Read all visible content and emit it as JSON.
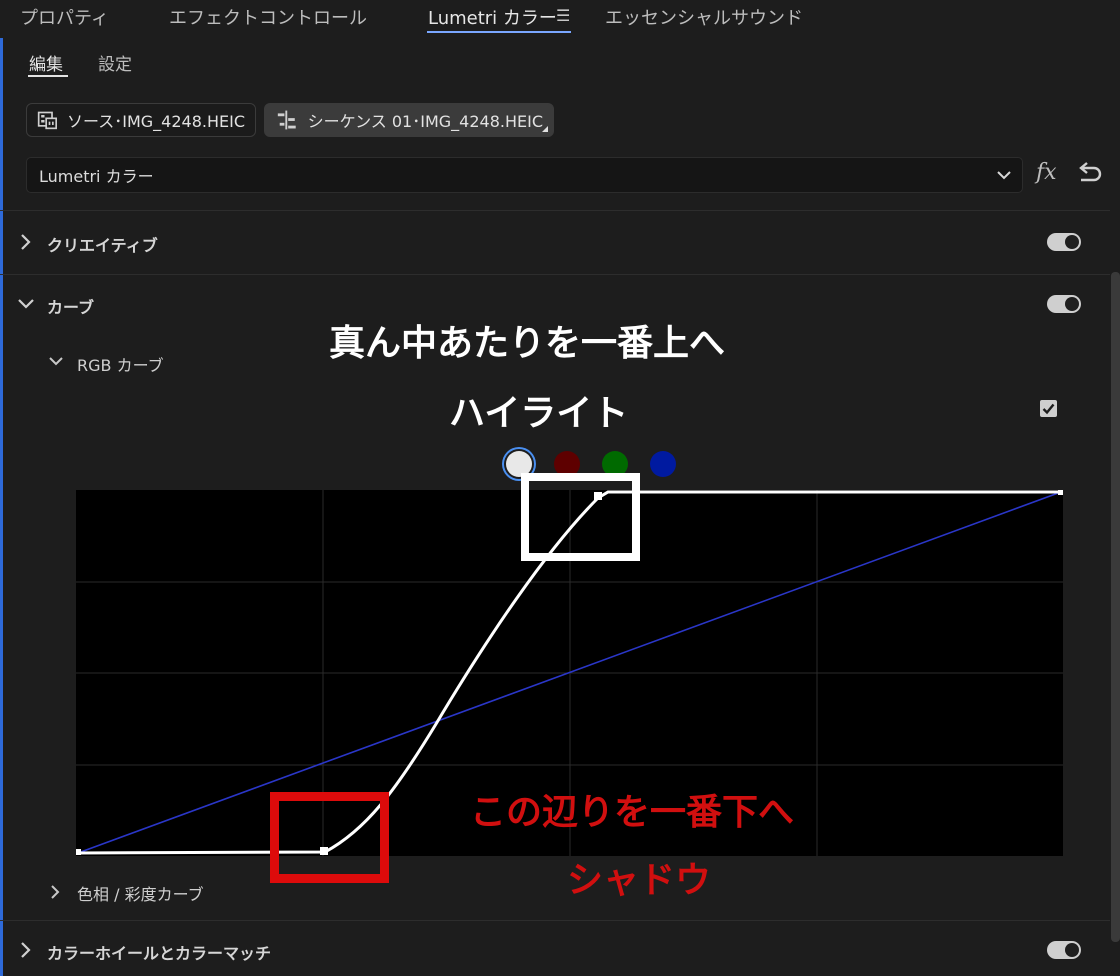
{
  "tabs": [
    {
      "label": "プロパティ",
      "active": false
    },
    {
      "label": "エフェクトコントロール",
      "active": false
    },
    {
      "label": "Lumetri カラー",
      "active": true
    },
    {
      "label": "エッセンシャルサウンド",
      "active": false
    }
  ],
  "subtabs": [
    {
      "label": "編集",
      "active": true
    },
    {
      "label": "設定",
      "active": false
    }
  ],
  "clips": {
    "source_label": "ソース･IMG_4248.HEIC",
    "sequence_label": "シーケンス 01･IMG_4248.HEIC"
  },
  "effect_dropdown": {
    "selected": "Lumetri カラー"
  },
  "sections": {
    "creative": "クリエイティブ",
    "curves": "カーブ",
    "rgb_curves": "RGB カーブ",
    "hue_sat_curves": "色相 / 彩度カーブ",
    "wheels": "カラーホイールとカラーマッチ"
  },
  "annotations": {
    "top_line1": "真ん中あたりを一番上へ",
    "top_line2": "ハイライト",
    "bottom_line1": "この辺りを一番下へ",
    "bottom_line2": "シャドウ"
  },
  "channels": [
    "white",
    "red",
    "green",
    "blue"
  ],
  "colors": {
    "accent": "#2e6ad9",
    "annotation_white": "#ffffff",
    "annotation_red": "#d10f0f",
    "box_red": "#dd0b0b",
    "curve_white": "#ffffff",
    "curve_blue": "#2a36c8",
    "channel_white": "#e8e8e8",
    "channel_red": "#5e0000",
    "channel_green": "#006a00",
    "channel_blue": "#001aa0"
  },
  "curve": {
    "white_points": [
      [
        0,
        0
      ],
      [
        0.25,
        0.01
      ],
      [
        0.53,
        1
      ],
      [
        1,
        1
      ]
    ],
    "blue_line": [
      [
        0,
        0
      ],
      [
        1,
        1
      ]
    ],
    "checkbox_checked": true
  },
  "icons": {
    "menu": "hamburger-icon",
    "fx": "fx-icon",
    "reset": "reset-icon",
    "dropdown": "chevron-down-icon",
    "source": "film-icon",
    "sequence": "sequence-icon"
  }
}
